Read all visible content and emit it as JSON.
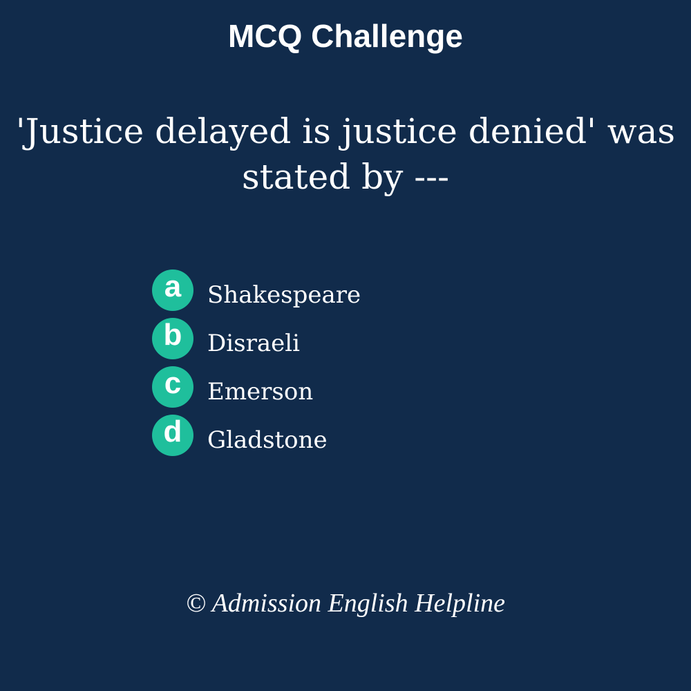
{
  "header": {
    "title": "MCQ Challenge"
  },
  "question": {
    "text": "'Justice delayed is justice denied' was stated by ---"
  },
  "options": [
    {
      "letter": "a",
      "text": "Shakespeare"
    },
    {
      "letter": "b",
      "text": "Disraeli"
    },
    {
      "letter": "c",
      "text": "Emerson"
    },
    {
      "letter": "d",
      "text": "Gladstone"
    }
  ],
  "footer": {
    "credit": "© Admission English Helpline"
  },
  "colors": {
    "background": "#112b4b",
    "badge": "#1fbf9c",
    "text": "#ffffff"
  }
}
